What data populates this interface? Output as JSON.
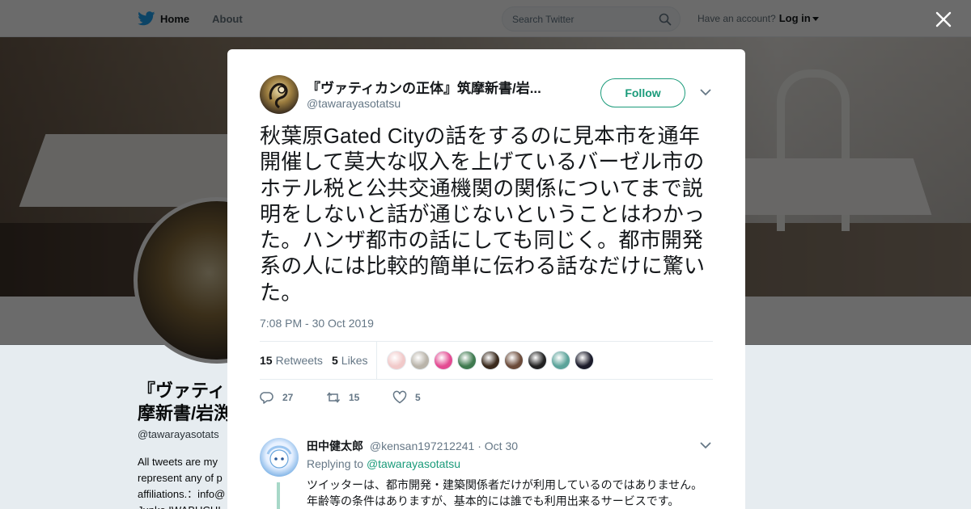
{
  "nav": {
    "home_label": "Home",
    "about_label": "About",
    "search_placeholder": "Search Twitter",
    "have_account": "Have an account?",
    "login_label": "Log in"
  },
  "profile_bg": {
    "name": "『ヴァティ 摩新書/岩渕",
    "handle": "@tawarayasotats",
    "bio": "All tweets are my represent any of p affiliations.：info@ Junko IWABUCHI"
  },
  "tweet": {
    "display_name": "『ヴァティカンの正体』筑摩新書/岩...",
    "screen_name": "@tawarayasotatsu",
    "follow_label": "Follow",
    "text": "秋葉原Gated Cityの話をするのに見本市を通年開催して莫大な収入を上げているバーゼル市のホテル税と公共交通機関の関係についてまで説明をしないと話が通じないということはわかった。ハンザ都市の話にしても同じく。都市開発系の人には比較的簡単に伝わる話なだけに驚いた。",
    "timestamp": "7:08 PM - 30 Oct 2019",
    "retweets_count": "15",
    "retweets_label": "Retweets",
    "likes_count": "5",
    "likes_label": "Likes",
    "likers": [
      {
        "name": "liker-1",
        "color": "#f1c9c9"
      },
      {
        "name": "liker-2",
        "color": "#b9b4aa"
      },
      {
        "name": "liker-3",
        "color": "#e34b92"
      },
      {
        "name": "liker-4",
        "color": "#3f7a4f"
      },
      {
        "name": "liker-5",
        "color": "#3a2a1d"
      },
      {
        "name": "liker-6",
        "color": "#6b4b3a"
      },
      {
        "name": "liker-7",
        "color": "#222222"
      },
      {
        "name": "liker-8",
        "color": "#5ba39a"
      },
      {
        "name": "liker-9",
        "color": "#1b1b2a"
      }
    ],
    "reply_count": "27",
    "retweet_count_action": "15",
    "like_count_action": "5"
  },
  "reply": {
    "name": "田中健太郎",
    "handle": "@kensan197212241",
    "date": "· Oct 30",
    "replying_prefix": "Replying to",
    "replying_to": "@tawarayasotatsu",
    "text_line1": "ツイッターは、都市開発・建築関係者だけが利用しているのではありません。",
    "text_line2": "年齢等の条件はありますが、基本的には誰でも利用出来るサービスです。"
  },
  "colors": {
    "accent": "#1a9b7a",
    "twitter_blue": "#1da1f2",
    "muted": "#657786"
  }
}
